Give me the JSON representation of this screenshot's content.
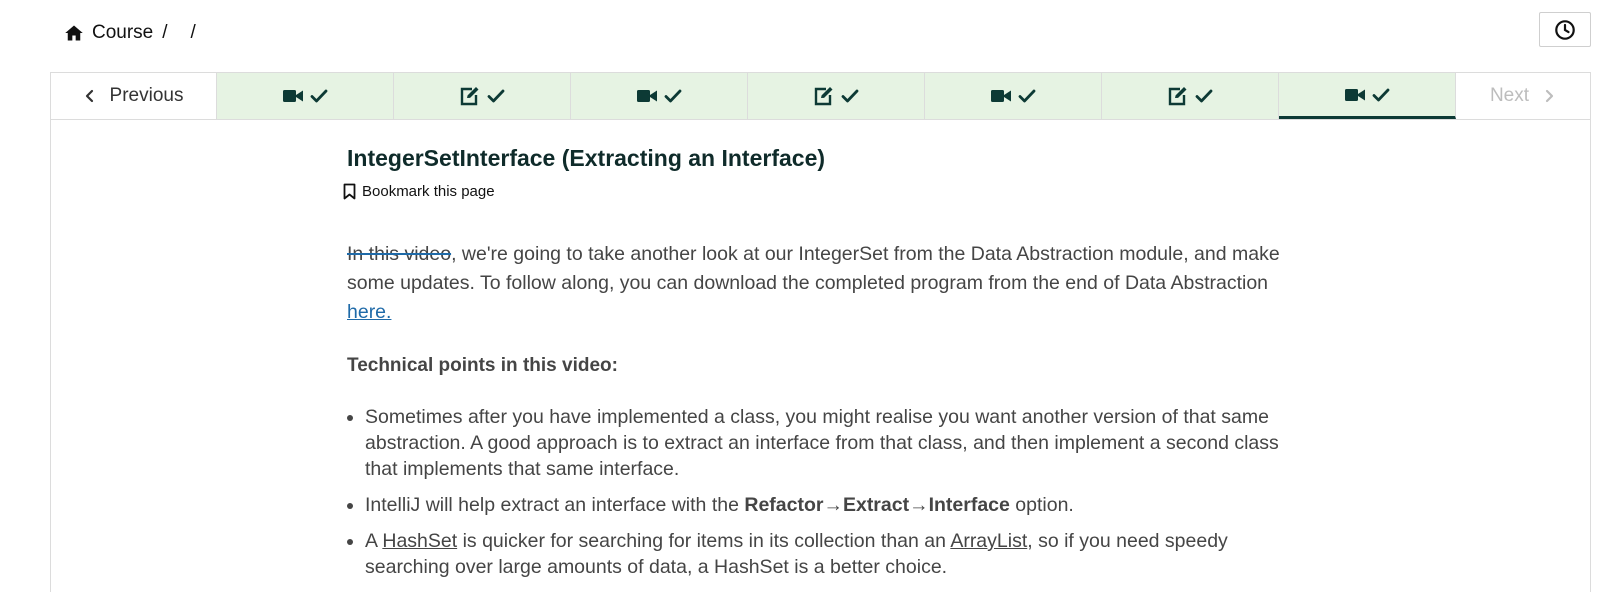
{
  "breadcrumb": {
    "course": "Course",
    "sep1": "/",
    "sep2": "/"
  },
  "nav": {
    "previous": "Previous",
    "next": "Next",
    "tabs": [
      {
        "icon": "video-icon",
        "status": "check-icon",
        "active": false
      },
      {
        "icon": "edit-icon",
        "status": "check-icon",
        "active": false
      },
      {
        "icon": "video-icon",
        "status": "check-icon",
        "active": false
      },
      {
        "icon": "edit-icon",
        "status": "check-icon",
        "active": false
      },
      {
        "icon": "video-icon",
        "status": "check-icon",
        "active": false
      },
      {
        "icon": "edit-icon",
        "status": "check-icon",
        "active": false
      },
      {
        "icon": "video-icon",
        "status": "check-icon",
        "active": true
      }
    ]
  },
  "page": {
    "title": "IntegerSetInterface (Extracting an Interface)",
    "bookmark": "Bookmark this page"
  },
  "intro": {
    "struck": "In this video",
    "text": ", we're going to take another look at our IntegerSet from the Data Abstraction module, and make some updates. To follow along, you can download the completed program from the end of Data Abstraction ",
    "link": "here."
  },
  "section_heading": "Technical points in this video:",
  "points": {
    "p1": "Sometimes after you have implemented a class, you might realise you want another version of that same abstraction. A good approach is to extract an interface from that class, and then implement a second class that implements that same interface.",
    "p2_pre": "IntelliJ will help extract an interface with the ",
    "p2_bold": "Refactor→Extract→Interface",
    "p2_post": " option.",
    "p3_a": "A ",
    "p3_hashset": "HashSet",
    "p3_b": " is quicker for searching for items in its collection than an ",
    "p3_arraylist": "ArrayList",
    "p3_c": ", so if you need speedy searching over large amounts of data, a HashSet is a better choice."
  },
  "colors": {
    "accent": "#0d3a35",
    "tab_bg": "#e6f3e3",
    "link": "#1f6aa8"
  }
}
